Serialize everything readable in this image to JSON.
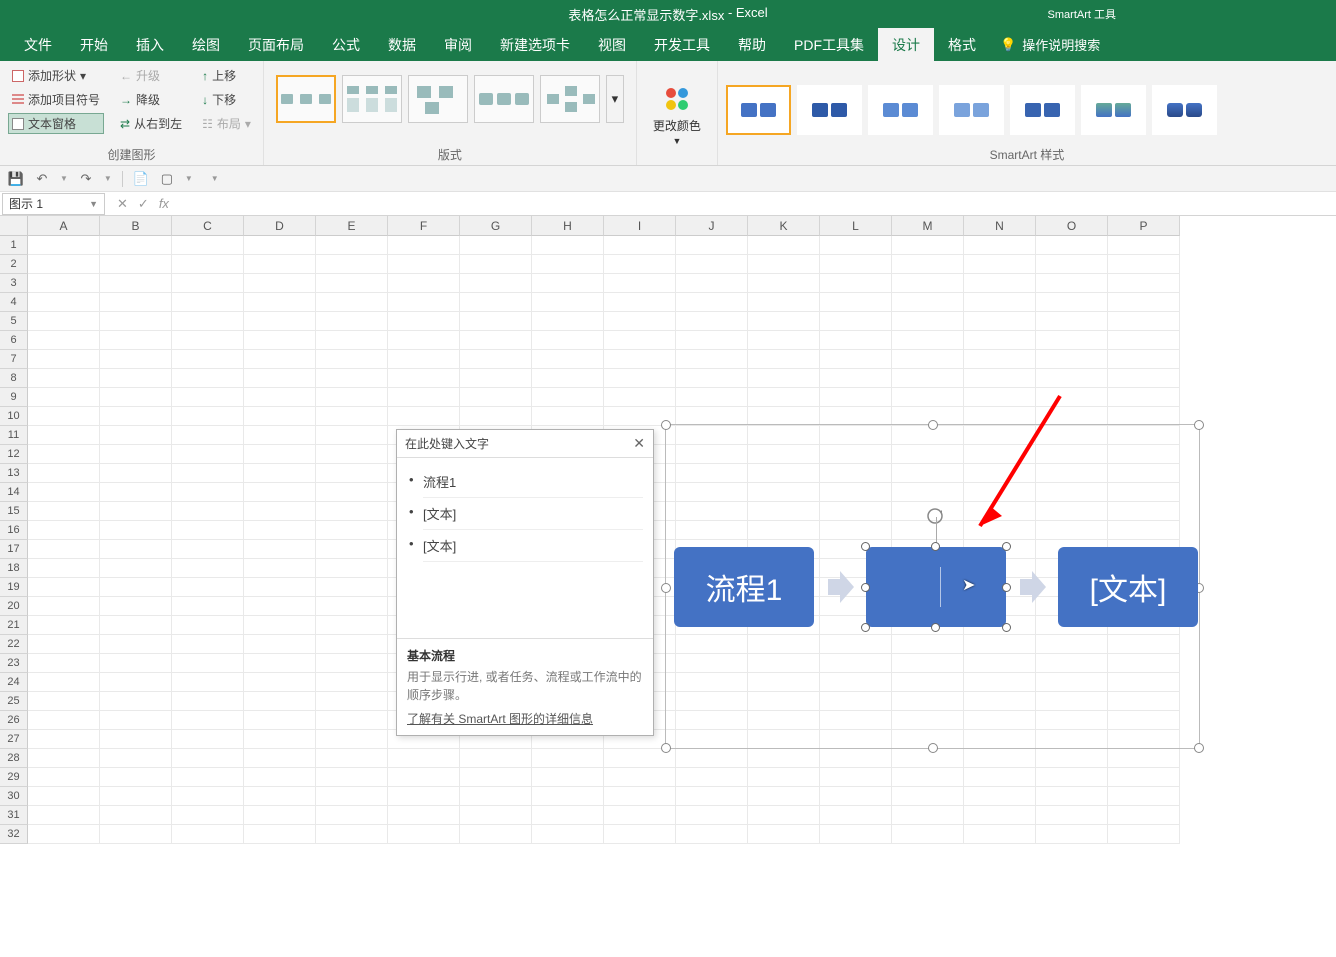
{
  "title": {
    "filename": "表格怎么正常显示数字.xlsx",
    "app": "Excel"
  },
  "context_tab": "SmartArt 工具",
  "tabs": [
    "文件",
    "开始",
    "插入",
    "绘图",
    "页面布局",
    "公式",
    "数据",
    "审阅",
    "新建选项卡",
    "视图",
    "开发工具",
    "帮助",
    "PDF工具集",
    "设计",
    "格式"
  ],
  "active_tab_index": 13,
  "tell_me": "操作说明搜索",
  "ribbon": {
    "create": {
      "add_shape": "添加形状",
      "add_bullet": "添加项目符号",
      "text_pane": "文本窗格",
      "promote": "升级",
      "demote": "降级",
      "rtl": "从右到左",
      "move_up": "上移",
      "move_down": "下移",
      "layout": "布局",
      "label": "创建图形"
    },
    "layouts_label": "版式",
    "change_colors": "更改颜色",
    "styles_label": "SmartArt 样式"
  },
  "namebox": "图示 1",
  "columns": [
    "A",
    "B",
    "C",
    "D",
    "E",
    "F",
    "G",
    "H",
    "I",
    "J",
    "K",
    "L",
    "M",
    "N",
    "O",
    "P"
  ],
  "row_count": 32,
  "text_pane": {
    "header": "在此处键入文字",
    "items": [
      "流程1",
      "[文本]",
      "[文本]"
    ],
    "footer_title": "基本流程",
    "footer_desc": "用于显示行进, 或者任务、流程或工作流中的顺序步骤。",
    "footer_link": "了解有关 SmartArt 图形的详细信息"
  },
  "smartart": {
    "shapes": [
      "流程1",
      "",
      "[文本]"
    ]
  }
}
